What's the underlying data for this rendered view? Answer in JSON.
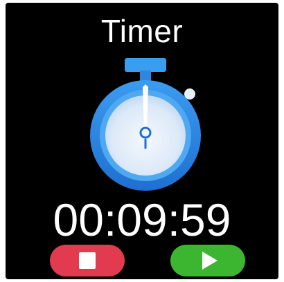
{
  "app": {
    "title": "Timer"
  },
  "timer": {
    "display": "00:09:59"
  },
  "controls": {
    "stop_icon": "stop-icon",
    "play_icon": "play-icon"
  },
  "colors": {
    "background": "#000000",
    "text": "#ffffff",
    "stop_button": "#e23a4f",
    "play_button": "#3cb531",
    "stopwatch_blue": "#2f8fe6"
  }
}
